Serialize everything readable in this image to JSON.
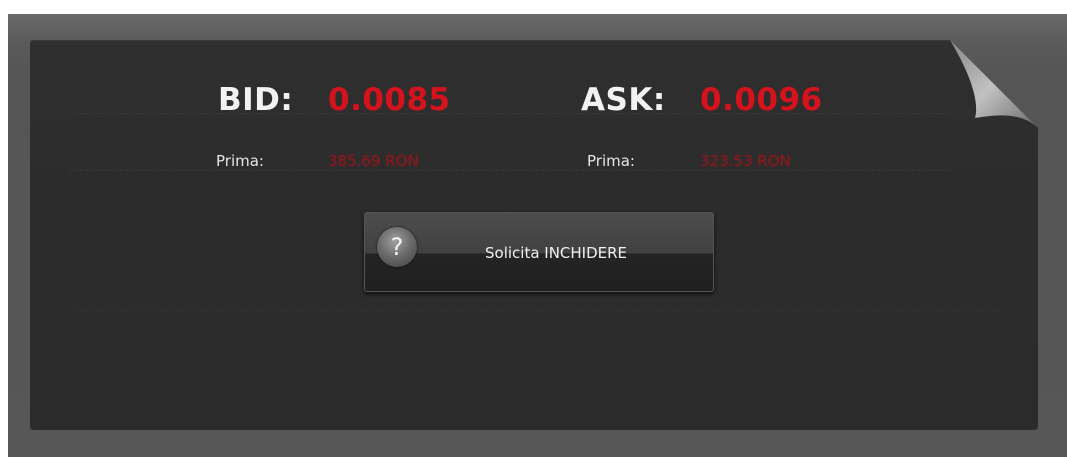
{
  "bid": {
    "label": "BID:",
    "value": "0.0085",
    "premium_label": "Prima:",
    "premium_value": "385.69 RON"
  },
  "ask": {
    "label": "ASK:",
    "value": "0.0096",
    "premium_label": "Prima:",
    "premium_value": "323.53 RON"
  },
  "action_button": {
    "label": "Solicita INCHIDERE",
    "icon": "question-icon",
    "icon_glyph": "?"
  },
  "colors": {
    "price_red": "#d3141e",
    "panel_bg": "#2c2c2c",
    "frame_bg": "#5a5a5a"
  }
}
